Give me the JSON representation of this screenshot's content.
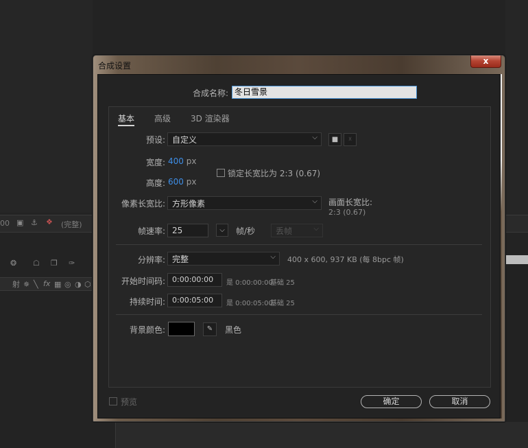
{
  "background": {
    "panel_label": "(完整)",
    "zoom_fragment": "00"
  },
  "dialog": {
    "title": "合成设置",
    "close_glyph": "x",
    "comp_name_label": "合成名称:",
    "comp_name_value": "冬日雪景",
    "tabs": [
      {
        "label": "基本"
      },
      {
        "label": "高级"
      },
      {
        "label": "3D 渲染器"
      }
    ],
    "preset": {
      "label": "预设:",
      "value": "自定义"
    },
    "width": {
      "label": "宽度:",
      "value": "400",
      "unit": "px"
    },
    "height": {
      "label": "高度:",
      "value": "600",
      "unit": "px"
    },
    "lock_aspect": {
      "label": "锁定长宽比为 2:3 (0.67)",
      "checked": false
    },
    "pixel_aspect": {
      "label": "像素长宽比:",
      "value": "方形像素"
    },
    "frame_aspect": {
      "label": "画面长宽比:",
      "value": "2:3 (0.67)"
    },
    "frame_rate": {
      "label": "帧速率:",
      "value": "25",
      "unit": "帧/秒",
      "drop_frame": "丢帧"
    },
    "resolution": {
      "label": "分辨率:",
      "value": "完整",
      "info": "400 x 600, 937 KB (每 8bpc 帧)"
    },
    "start_timecode": {
      "label": "开始时间码:",
      "value": "0:00:00:00",
      "info": "是 0:00:00:00",
      "base": "基础 25"
    },
    "duration": {
      "label": "持续时间:",
      "value": "0:00:05:00",
      "info": "是 0:00:05:00",
      "base": "基础 25"
    },
    "background_color": {
      "label": "背景颜色:",
      "name": "黑色",
      "hex": "#000000"
    },
    "preview_label": "预览",
    "ok_label": "确定",
    "cancel_label": "取消"
  }
}
